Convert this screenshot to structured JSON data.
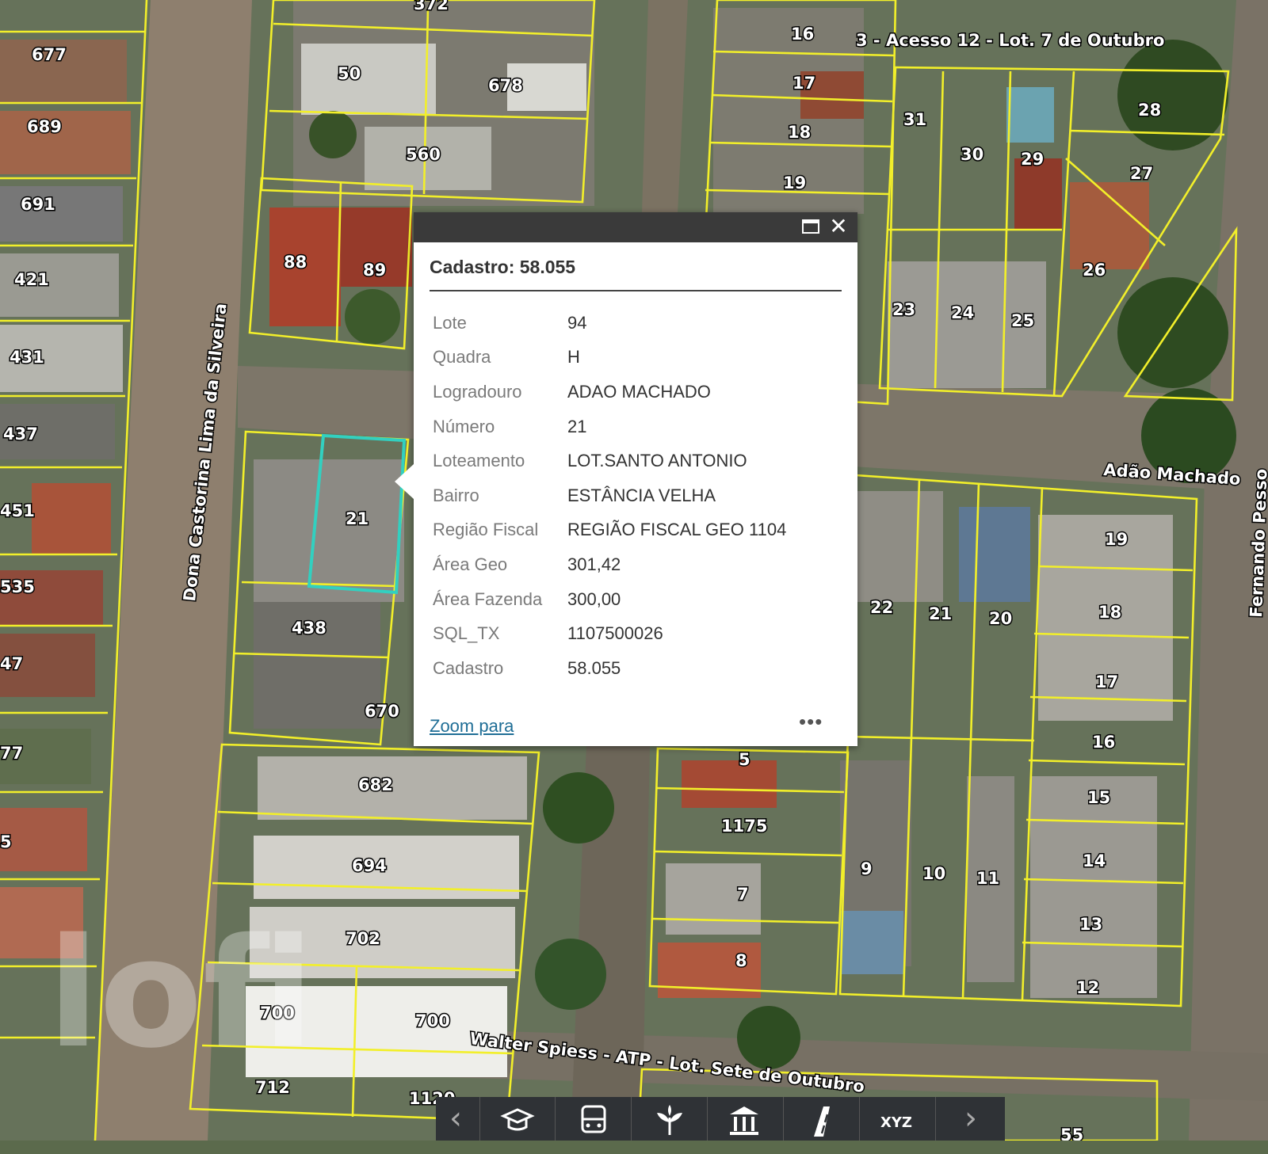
{
  "popup": {
    "title": "Cadastro: 58.055",
    "rows": [
      {
        "label": "Lote",
        "value": "94"
      },
      {
        "label": "Quadra",
        "value": "H"
      },
      {
        "label": "Logradouro",
        "value": "ADAO MACHADO"
      },
      {
        "label": "Número",
        "value": "21"
      },
      {
        "label": "Loteamento",
        "value": "LOT.SANTO ANTONIO"
      },
      {
        "label": "Bairro",
        "value": "ESTÂNCIA VELHA"
      },
      {
        "label": "Região Fiscal",
        "value": "REGIÃO FISCAL GEO 1104"
      },
      {
        "label": "Área Geo",
        "value": "301,42"
      },
      {
        "label": "Área Fazenda",
        "value": "300,00"
      },
      {
        "label": "SQL_TX",
        "value": "1107500026"
      },
      {
        "label": "Cadastro",
        "value": "58.055"
      }
    ],
    "zoom_link": "Zoom para",
    "more": "•••",
    "close_glyph": "✕"
  },
  "streets": {
    "dona_castorina": "Dona Castorina Lima da Silveira",
    "acesso_12": "3 - Acesso 12 - Lot. 7 de Outubro",
    "adao_machado": "Adão Machado",
    "walter_spiess": "Walter Spiess - ATP - Lot. Sete de Outubro",
    "fernando": "Fernando Pesso"
  },
  "parcels": {
    "l372": "372",
    "l677": "677",
    "l689": "689",
    "l691": "691",
    "l421": "421",
    "l431": "431",
    "l437": "437",
    "l451": "451",
    "l535": "535",
    "l47": "47",
    "l77": "77",
    "l5a": "5",
    "l50": "50",
    "l678": "678",
    "l560": "560",
    "l88": "88",
    "l89": "89",
    "l21sel": "21",
    "l438": "438",
    "l670": "670",
    "l682": "682",
    "l694": "694",
    "l702": "702",
    "l700a": "700",
    "l700b": "700",
    "l712": "712",
    "l1120": "1120",
    "l16a": "16",
    "l17a": "17",
    "l18a": "18",
    "l19a": "19",
    "l31": "31",
    "l30": "30",
    "l29": "29",
    "l28": "28",
    "l27": "27",
    "l26": "26",
    "l23": "23",
    "l24": "24",
    "l25": "25",
    "l22": "22",
    "l21b": "21",
    "l20": "20",
    "l19b": "19",
    "l18b": "18",
    "l17b": "17",
    "l16b": "16",
    "l15": "15",
    "l14": "14",
    "l13": "13",
    "l12": "12",
    "l11": "11",
    "l10": "10",
    "l9": "9",
    "l8": "8",
    "l7": "7",
    "l1175": "1175",
    "l5b": "5",
    "l55": "55"
  },
  "watermark": "lofi",
  "toolbar": {
    "prev": "‹",
    "next": "›",
    "xyz": "XYZ"
  }
}
